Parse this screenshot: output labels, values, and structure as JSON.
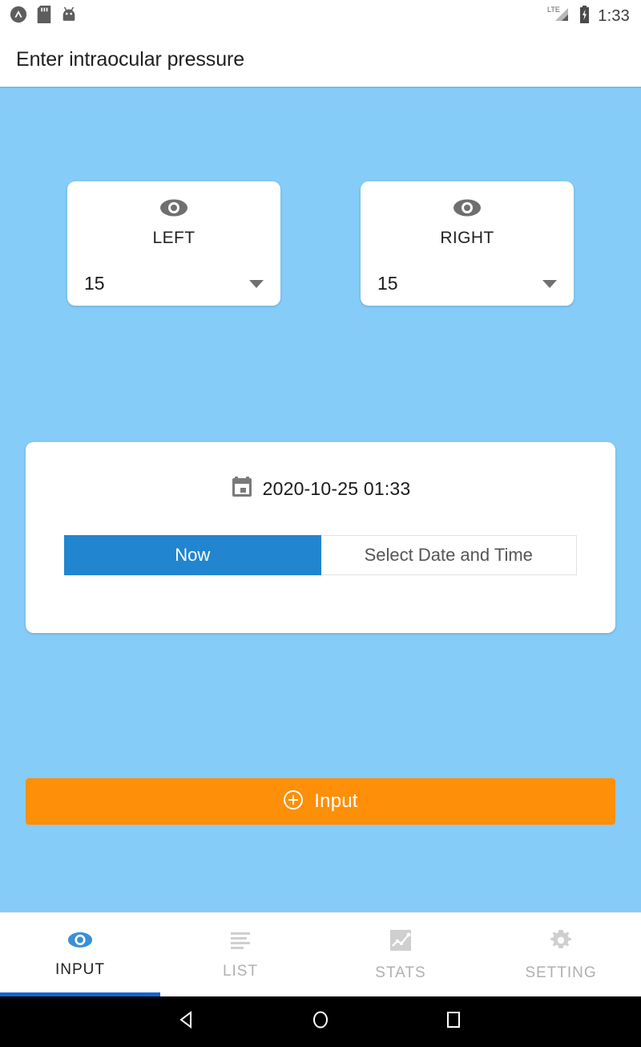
{
  "status_bar": {
    "icons_left": [
      "app-logo-icon",
      "sd-card-icon",
      "android-robot-icon"
    ],
    "icons_right": [
      "lte-signal-icon",
      "battery-charging-icon"
    ],
    "network_label": "LTE",
    "time": "1:33"
  },
  "app_bar": {
    "title": "Enter intraocular pressure"
  },
  "eyes": [
    {
      "icon": "eye-icon",
      "label": "LEFT",
      "value": "15",
      "caret": "dropdown-caret-icon"
    },
    {
      "icon": "eye-icon",
      "label": "RIGHT",
      "value": "15",
      "caret": "dropdown-caret-icon"
    }
  ],
  "date_card": {
    "calendar_icon": "calendar-icon",
    "datetime": "2020-10-25 01:33",
    "segments": [
      {
        "label": "Now",
        "selected": true
      },
      {
        "label": "Select Date and Time",
        "selected": false
      }
    ]
  },
  "input_button": {
    "icon": "plus-circle-icon",
    "label": "Input"
  },
  "bottom_nav": {
    "items": [
      {
        "label": "INPUT",
        "icon": "eye-icon",
        "active": true
      },
      {
        "label": "LIST",
        "icon": "list-icon",
        "active": false
      },
      {
        "label": "STATS",
        "icon": "chart-icon",
        "active": false
      },
      {
        "label": "SETTING",
        "icon": "gear-icon",
        "active": false
      }
    ]
  },
  "android_nav": {
    "back": "back-triangle-icon",
    "home": "home-circle-icon",
    "recents": "recents-square-icon"
  },
  "colors": {
    "background": "#85ccf8",
    "accent_blue": "#2185d0",
    "indicator_blue": "#0b67d0",
    "orange": "#fd8f09",
    "icon_gray": "#757575",
    "nav_inactive": "#b0b0b0"
  }
}
